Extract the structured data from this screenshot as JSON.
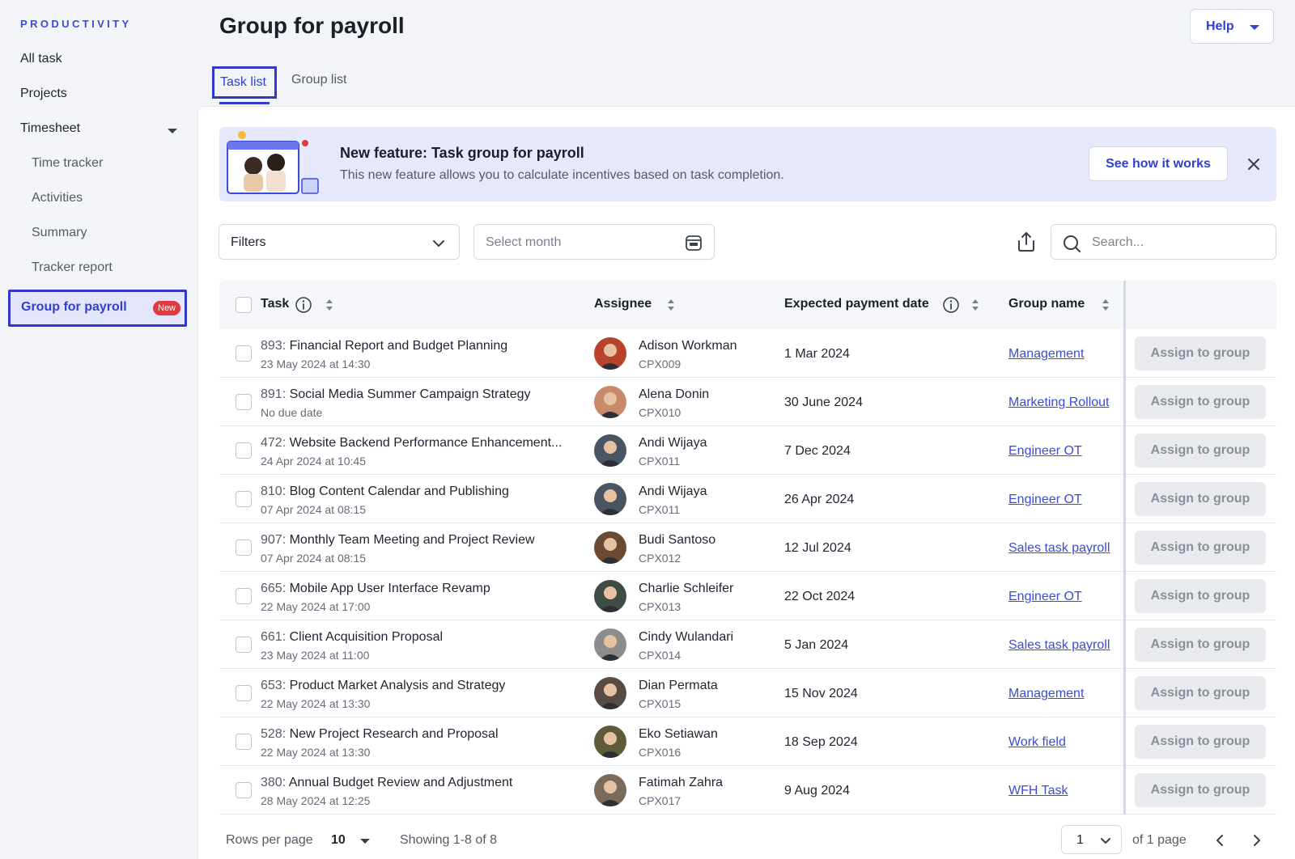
{
  "sidebar": {
    "section": "PRODUCTIVITY",
    "items": [
      {
        "label": "All task"
      },
      {
        "label": "Projects"
      },
      {
        "label": "Timesheet"
      },
      {
        "label": "Time tracker"
      },
      {
        "label": "Activities"
      },
      {
        "label": "Summary"
      },
      {
        "label": "Tracker report"
      },
      {
        "label": "Group for payroll",
        "badge": "New"
      }
    ]
  },
  "header": {
    "title": "Group for payroll",
    "help_label": "Help"
  },
  "tabs": [
    {
      "label": "Task list",
      "active": true
    },
    {
      "label": "Group list",
      "active": false
    }
  ],
  "banner": {
    "title": "New feature: Task group for payroll",
    "description": "This new feature allows you to calculate incentives based on task completion.",
    "button": "See how it works"
  },
  "toolbar": {
    "filters_label": "Filters",
    "month_placeholder": "Select month",
    "search_placeholder": "Search..."
  },
  "table": {
    "columns": [
      "Task",
      "Assignee",
      "Expected payment date",
      "Group name"
    ],
    "action_label": "Assign to group",
    "rows": [
      {
        "num": "893:",
        "title": "Financial Report and Budget Planning",
        "sub": "23 May 2024 at 14:30",
        "assignee": "Adison Workman",
        "id": "CPX009",
        "date": "1 Mar 2024",
        "group": "Management"
      },
      {
        "num": "891:",
        "title": "Social Media Summer Campaign Strategy",
        "sub": "No due date",
        "assignee": "Alena Donin",
        "id": "CPX010",
        "date": "30 June 2024",
        "group": "Marketing Rollout"
      },
      {
        "num": "472:",
        "title": "Website Backend Performance Enhancement...",
        "sub": "24 Apr 2024 at 10:45",
        "assignee": "Andi Wijaya",
        "id": "CPX011",
        "date": "7 Dec 2024",
        "group": "Engineer OT"
      },
      {
        "num": "810:",
        "title": "Blog Content Calendar and Publishing",
        "sub": "07 Apr 2024 at 08:15",
        "assignee": "Andi Wijaya",
        "id": "CPX011",
        "date": "26 Apr 2024",
        "group": "Engineer OT"
      },
      {
        "num": "907:",
        "title": "Monthly Team Meeting and Project Review",
        "sub": "07 Apr 2024 at 08:15",
        "assignee": "Budi Santoso",
        "id": "CPX012",
        "date": "12 Jul 2024",
        "group": "Sales task payroll"
      },
      {
        "num": "665:",
        "title": "Mobile App User Interface Revamp",
        "sub": "22 May 2024 at 17:00",
        "assignee": "Charlie Schleifer",
        "id": "CPX013",
        "date": "22 Oct 2024",
        "group": "Engineer OT"
      },
      {
        "num": "661:",
        "title": "Client Acquisition Proposal",
        "sub": "23 May 2024 at 11:00",
        "assignee": "Cindy Wulandari",
        "id": "CPX014",
        "date": "5 Jan 2024",
        "group": "Sales task payroll"
      },
      {
        "num": "653:",
        "title": "Product Market Analysis and Strategy",
        "sub": "22 May 2024 at 13:30",
        "assignee": "Dian Permata",
        "id": "CPX015",
        "date": "15 Nov 2024",
        "group": "Management"
      },
      {
        "num": "528:",
        "title": "New Project Research and Proposal",
        "sub": "22 May 2024 at 13:30",
        "assignee": "Eko Setiawan",
        "id": "CPX016",
        "date": "18 Sep 2024",
        "group": "Work field"
      },
      {
        "num": "380:",
        "title": "Annual Budget Review and Adjustment",
        "sub": "28 May 2024 at 12:25",
        "assignee": "Fatimah Zahra",
        "id": "CPX017",
        "date": "9 Aug 2024",
        "group": "WFH Task"
      }
    ]
  },
  "footer": {
    "rows_label": "Rows per page",
    "rows_value": "10",
    "showing": "Showing 1-8 of 8",
    "page_value": "1",
    "of_pages": "of 1 page"
  },
  "colors": {
    "accent": "#2f3fd0",
    "badge": "#e0393e",
    "banner_bg": "#e6e9fb"
  },
  "icons": [
    "caret-down-icon",
    "close-icon",
    "chevron-down-icon",
    "calendar-icon",
    "export-icon",
    "search-icon",
    "info-icon",
    "sort-icon",
    "chevron-left-icon",
    "chevron-right-icon"
  ]
}
